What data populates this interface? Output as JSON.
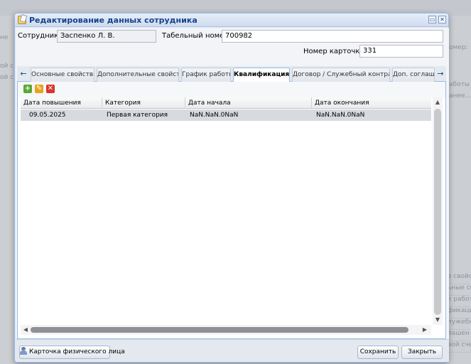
{
  "background": {
    "left_texts": [
      "не",
      "ой с",
      "ой с"
    ],
    "right_top_text": "омер:",
    "right_texts": [
      "аботы",
      "анее..."
    ],
    "right_stack": [
      "е свойс",
      "ьные св",
      "к работ",
      "фикаци",
      "лужебный",
      "лашен",
      "вой счет"
    ]
  },
  "window": {
    "title": "Редактирование данных сотрудника",
    "btn_restore": "▭",
    "btn_close": "✕"
  },
  "form": {
    "employee_label": "Сотрудник:",
    "employee_value": "Заспенко Л. В.",
    "tabnum_label": "Табельный номер:",
    "tabnum_value": "700982",
    "card_label": "Номер карточки:",
    "card_value": "331"
  },
  "tabs": {
    "scroll_left": "←",
    "scroll_right": "→",
    "items": [
      {
        "label": "Основные свойства"
      },
      {
        "label": "Дополнительные свойства"
      },
      {
        "label": "График работы"
      },
      {
        "label": "Квалификация"
      },
      {
        "label": "Договор / Служебный контракт"
      },
      {
        "label": "Доп. соглашения"
      }
    ]
  },
  "toolbar": {
    "add": "+",
    "edit": "✎",
    "delete": "✕"
  },
  "grid": {
    "columns": [
      "Дата повышения",
      "Категория",
      "Дата начала",
      "Дата окончания"
    ],
    "rows": [
      [
        "09.05.2025",
        "Первая категория",
        "NaN.NaN.0NaN",
        "NaN.NaN.0NaN"
      ]
    ]
  },
  "scroll": {
    "up": "▲",
    "down": "▼",
    "left": "◀",
    "right": "▶"
  },
  "footer": {
    "person_card": "Карточка физического лица",
    "save": "Сохранить",
    "close": "Закрыть"
  },
  "colors": {
    "title_text": "#15428b",
    "tb_add": "#5aa832",
    "tb_edit": "#e8a317",
    "tb_delete": "#d9332b"
  }
}
